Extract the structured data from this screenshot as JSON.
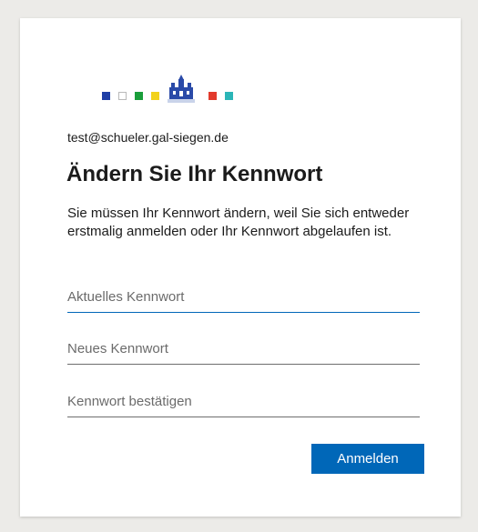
{
  "account": {
    "email": "test@schueler.gal-siegen.de"
  },
  "logo": {
    "icon": "school-crest-logo",
    "colors": [
      "#1f3fa6",
      "#ffffff",
      "#1a9e3b",
      "#f2d21b",
      "#e23a2c",
      "#2bb5b7"
    ]
  },
  "page": {
    "title": "Ändern Sie Ihr Kennwort",
    "description": "Sie müssen Ihr Kennwort ändern, weil Sie sich entweder erstmalig anmelden oder Ihr Kennwort abgelaufen ist."
  },
  "form": {
    "current_password": {
      "placeholder": "Aktuelles Kennwort",
      "value": ""
    },
    "new_password": {
      "placeholder": "Neues Kennwort",
      "value": ""
    },
    "confirm_password": {
      "placeholder": "Kennwort bestätigen",
      "value": ""
    },
    "submit_label": "Anmelden"
  },
  "colors": {
    "accent": "#0067b8",
    "background": "#ecebe8",
    "card": "#ffffff"
  }
}
